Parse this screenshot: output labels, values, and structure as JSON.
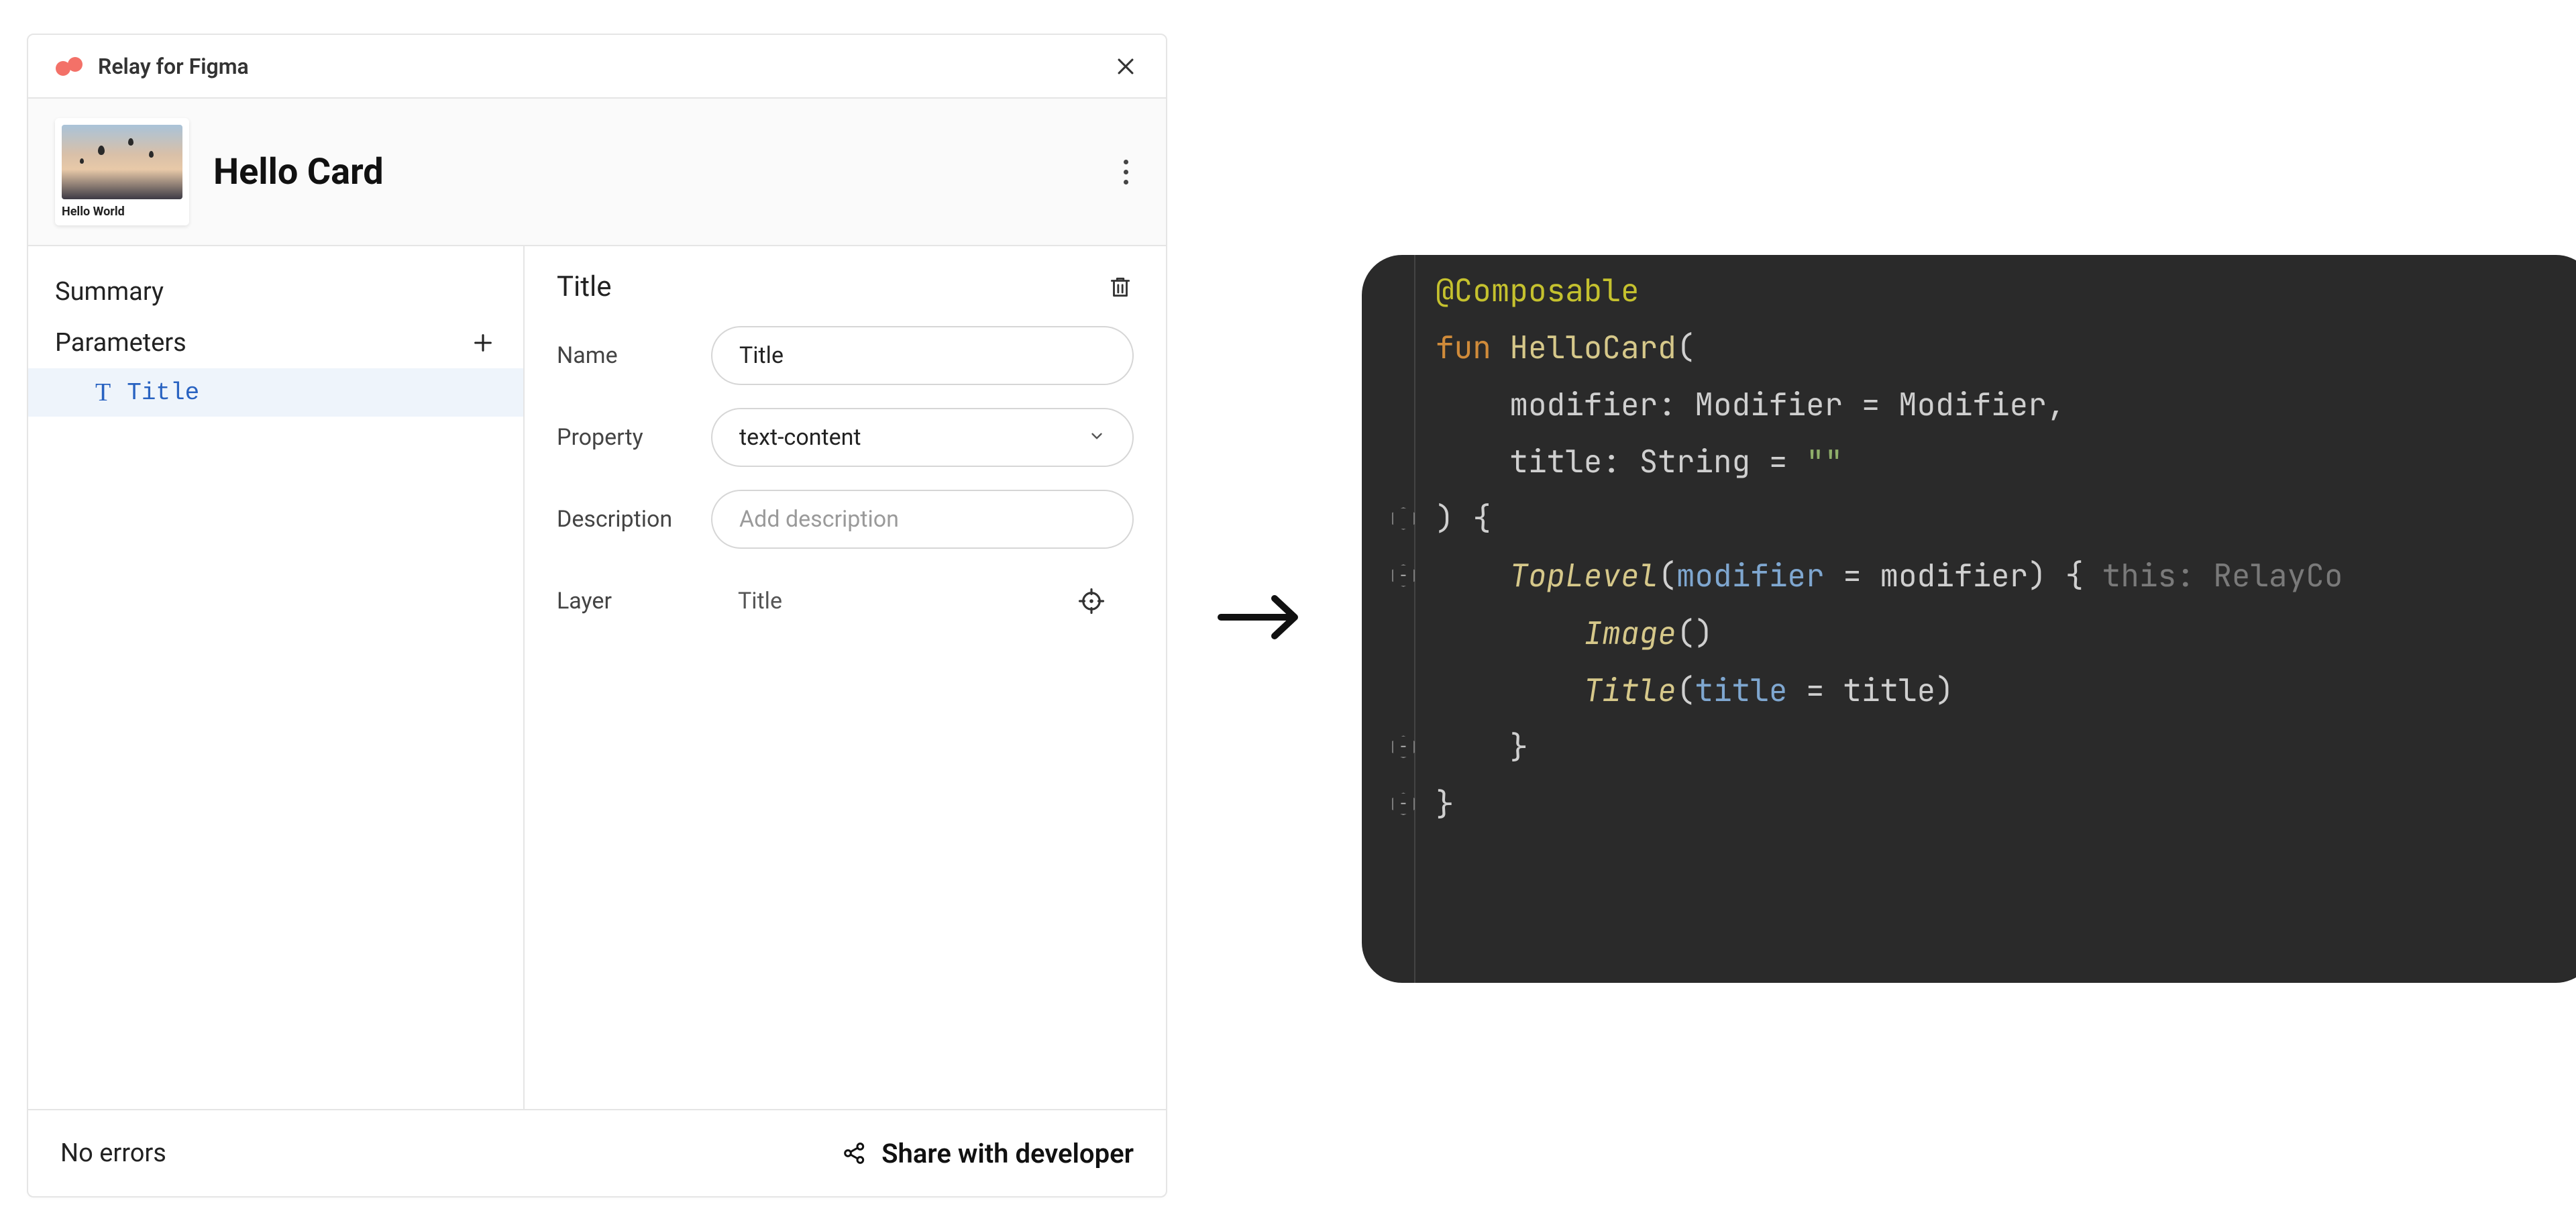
{
  "panel": {
    "app_title": "Relay for Figma",
    "component_name": "Hello Card",
    "thumb_caption": "Hello World",
    "sidebar": {
      "summary_label": "Summary",
      "parameters_label": "Parameters",
      "params": [
        {
          "label": "Title"
        }
      ]
    },
    "detail": {
      "title": "Title",
      "fields": {
        "name_label": "Name",
        "name_value": "Title",
        "property_label": "Property",
        "property_value": "text-content",
        "description_label": "Description",
        "description_placeholder": "Add description",
        "layer_label": "Layer",
        "layer_value": "Title"
      }
    },
    "footer": {
      "status": "No errors",
      "share_label": "Share with developer"
    }
  },
  "icons": {
    "close": "close-icon",
    "kebab": "kebab-icon",
    "plus": "plus-icon",
    "text_type": "text-type-icon",
    "trash": "trash-icon",
    "chevron_down": "chevron-down-icon",
    "target": "target-icon",
    "share": "share-icon",
    "arrow_right": "arrow-right-icon"
  },
  "code": {
    "tokens": [
      [
        {
          "t": "ann",
          "s": "@Composable"
        }
      ],
      [
        {
          "t": "kw",
          "s": "fun "
        },
        {
          "t": "fun-name",
          "s": "HelloCard"
        },
        {
          "t": "punc",
          "s": "("
        }
      ],
      [
        {
          "t": "punc",
          "s": "    "
        },
        {
          "t": "ident",
          "s": "modifier"
        },
        {
          "t": "punc",
          "s": ": "
        },
        {
          "t": "type",
          "s": "Modifier"
        },
        {
          "t": "punc",
          "s": " = "
        },
        {
          "t": "type",
          "s": "Modifier"
        },
        {
          "t": "punc",
          "s": ","
        }
      ],
      [
        {
          "t": "punc",
          "s": "    "
        },
        {
          "t": "ident",
          "s": "title"
        },
        {
          "t": "punc",
          "s": ": "
        },
        {
          "t": "type",
          "s": "String"
        },
        {
          "t": "punc",
          "s": " = "
        },
        {
          "t": "str",
          "s": "\"\""
        }
      ],
      [
        {
          "t": "punc",
          "s": ") {"
        }
      ],
      [
        {
          "t": "punc",
          "s": "    "
        },
        {
          "t": "fun",
          "s": "TopLevel"
        },
        {
          "t": "punc",
          "s": "("
        },
        {
          "t": "param",
          "s": "modifier"
        },
        {
          "t": "punc",
          "s": " = modifier) { "
        },
        {
          "t": "hint",
          "s": "this: RelayCo"
        }
      ],
      [
        {
          "t": "punc",
          "s": "        "
        },
        {
          "t": "fun",
          "s": "Image"
        },
        {
          "t": "punc",
          "s": "()"
        }
      ],
      [
        {
          "t": "punc",
          "s": "        "
        },
        {
          "t": "fun",
          "s": "Title"
        },
        {
          "t": "punc",
          "s": "("
        },
        {
          "t": "param",
          "s": "title"
        },
        {
          "t": "punc",
          "s": " = title)"
        }
      ],
      [
        {
          "t": "punc",
          "s": "    }"
        }
      ],
      [
        {
          "t": "punc",
          "s": "}"
        }
      ]
    ],
    "gutter_markers": [
      {
        "line": 4,
        "shape": "hex",
        "glyph": ""
      },
      {
        "line": 5,
        "shape": "hex",
        "glyph": "−"
      },
      {
        "line": 8,
        "shape": "hex",
        "glyph": "−"
      },
      {
        "line": 9,
        "shape": "hex",
        "glyph": "−"
      }
    ]
  },
  "colors": {
    "accent_blue": "#2862c1",
    "code_bg": "#2a2a2a",
    "logo_coral": "#f37168"
  }
}
